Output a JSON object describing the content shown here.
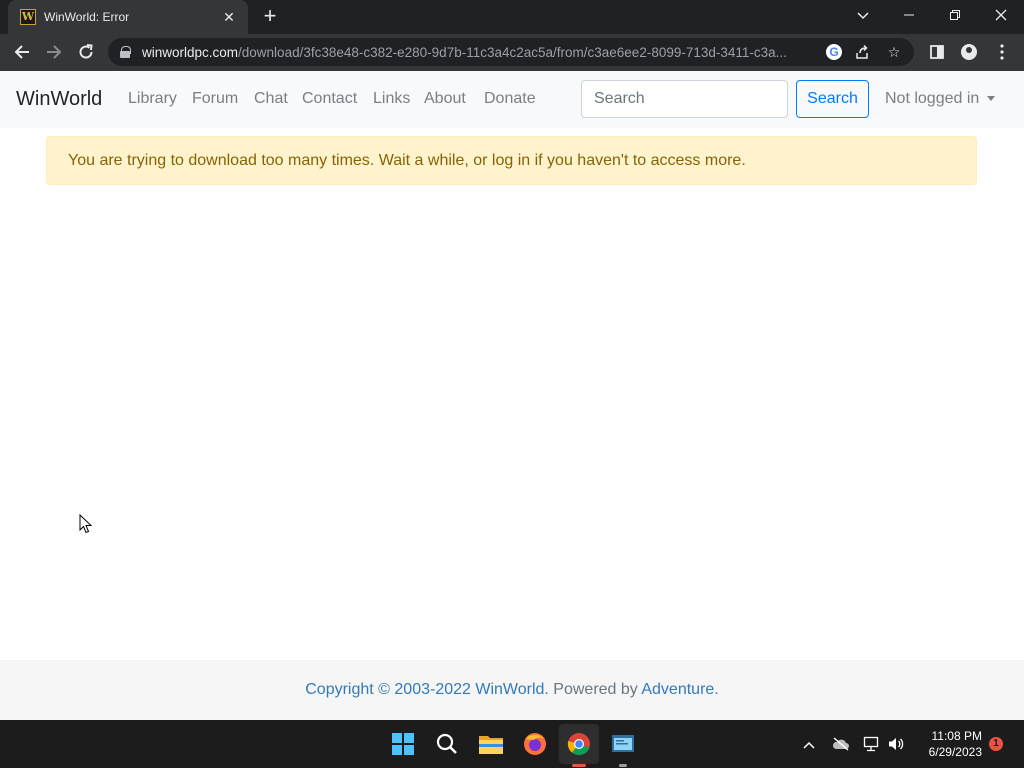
{
  "browser": {
    "tab_title": "WinWorld: Error",
    "tab_close": "✕",
    "new_tab": "+",
    "url_host": "winworldpc.com",
    "url_path": "/download/3fc38e48-c382-e280-9d7b-11c3a4c2ac5a/from/c3ae6ee2-8099-713d-3411-c3a..."
  },
  "site": {
    "brand": "WinWorld",
    "nav_links": [
      "Library",
      "Forum",
      "Chat",
      "Contact",
      "Links",
      "About",
      "Donate"
    ],
    "search_placeholder": "Search",
    "search_button": "Search",
    "user_menu": "Not logged in"
  },
  "alert": {
    "message": "You are trying to download too many times. Wait a while, or log in if you haven't to access more."
  },
  "footer": {
    "copyright": "Copyright © 2003-2022 WinWorld.",
    "powered_by": "Powered by",
    "powered_link": "Adventure."
  },
  "taskbar": {
    "time": "11:08 PM",
    "date": "6/29/2023",
    "notification_count": "1"
  },
  "colors": {
    "alert_bg": "#fff3cd",
    "alert_text": "#856404",
    "link": "#337ab7",
    "primary": "#007bff"
  }
}
